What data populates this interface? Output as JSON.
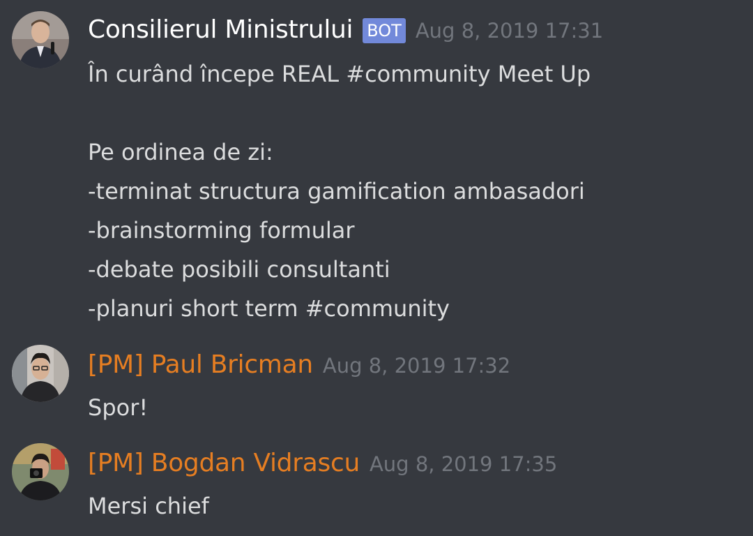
{
  "messages": [
    {
      "author": "Consilierul Ministrului",
      "bot_tag": "BOT",
      "timestamp": "Aug 8, 2019 17:31",
      "lines": [
        "În curând începe REAL #community Meet Up",
        "",
        "Pe ordinea de zi:",
        "-terminat structura gamification ambasadori",
        "-brainstorming formular",
        "-debate posibili consultanti",
        "-planuri short term #community"
      ]
    },
    {
      "author": "[PM] Paul Bricman",
      "timestamp": "Aug 8, 2019 17:32",
      "text": "Spor!"
    },
    {
      "author": "[PM] Bogdan Vidrascu",
      "timestamp": "Aug 8, 2019 17:35",
      "text": "Mersi chief"
    }
  ],
  "colors": {
    "background": "#36393f",
    "author_default": "#ffffff",
    "author_role_pm": "#e67e22",
    "bot_tag_bg": "#7289da",
    "timestamp": "#72767d",
    "message_text": "#dcddde"
  }
}
